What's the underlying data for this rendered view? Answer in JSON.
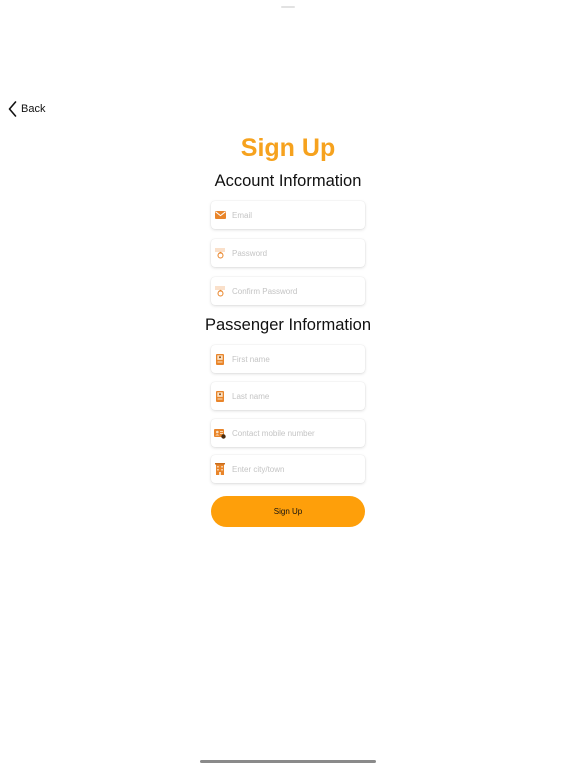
{
  "nav": {
    "back_label": "Back"
  },
  "title": "Sign Up",
  "account_section": {
    "heading": "Account Information",
    "fields": {
      "email": {
        "placeholder": "Email",
        "value": "",
        "icon": "envelope-icon"
      },
      "password": {
        "placeholder": "Password",
        "value": "",
        "icon": "password-icon"
      },
      "confirm_password": {
        "placeholder": "Confirm Password",
        "value": "",
        "icon": "password-icon"
      }
    }
  },
  "passenger_section": {
    "heading": "Passenger Information",
    "fields": {
      "first_name": {
        "placeholder": "First name",
        "value": "",
        "icon": "id-badge-icon"
      },
      "last_name": {
        "placeholder": "Last name",
        "value": "",
        "icon": "id-badge-icon"
      },
      "mobile": {
        "placeholder": "Contact mobile number",
        "value": "",
        "icon": "contact-card-icon"
      },
      "city": {
        "placeholder": "Enter city/town",
        "value": "",
        "icon": "building-icon"
      }
    }
  },
  "submit": {
    "label": "Sign Up"
  },
  "colors": {
    "accent": "#f6a21e",
    "button": "#fe9f0a",
    "icon": "#e9852a"
  }
}
